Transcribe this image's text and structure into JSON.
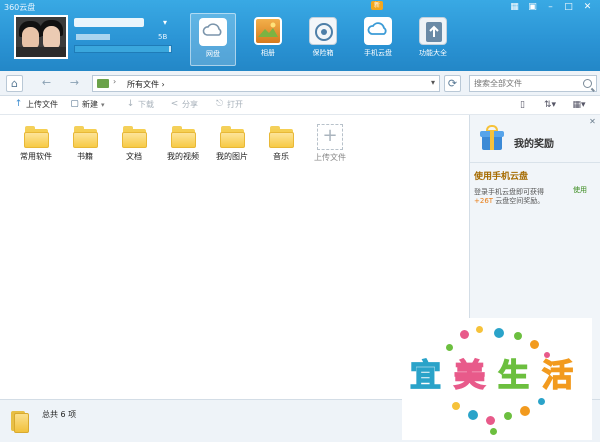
{
  "window": {
    "title": "360云盘",
    "controls": [
      {
        "name": "feedback-icon",
        "glyph": "▦"
      },
      {
        "name": "skin-icon",
        "glyph": "▣"
      },
      {
        "name": "minimize-icon",
        "glyph": "–"
      },
      {
        "name": "maximize-icon",
        "glyph": "□"
      },
      {
        "name": "close-icon",
        "glyph": "✕"
      }
    ]
  },
  "user": {
    "quota_label": "5B",
    "quota_used_fraction": 0.98,
    "menu_caret": "▾"
  },
  "nav": {
    "badge": "新",
    "items": [
      {
        "label": "网盘",
        "icon": "cloud-drive-icon",
        "active": true
      },
      {
        "label": "相册",
        "icon": "photo-album-icon",
        "active": false
      },
      {
        "label": "保险箱",
        "icon": "safe-box-icon",
        "active": false
      },
      {
        "label": "手机云盘",
        "icon": "mobile-cloud-icon",
        "active": false
      },
      {
        "label": "功能大全",
        "icon": "tools-icon",
        "active": false
      }
    ]
  },
  "addressbar": {
    "home_glyph": "⌂",
    "back_glyph": "←",
    "forward_glyph": "→",
    "path_separator": "›",
    "path_label": "所有文件 ›",
    "path_caret": "▾",
    "refresh_glyph": "⟳",
    "search_placeholder": "搜索全部文件"
  },
  "toolbar": {
    "upload": {
      "label": "上传文件",
      "glyph": "↑",
      "enabled": true
    },
    "new": {
      "label": "新建",
      "glyph": "▢",
      "caret": "▾",
      "enabled": true
    },
    "download": {
      "label": "下载",
      "glyph": "↓",
      "enabled": false
    },
    "share": {
      "label": "分享",
      "glyph": "<",
      "enabled": false
    },
    "open": {
      "label": "打开",
      "glyph": "⎋",
      "enabled": false
    },
    "view_controls": [
      {
        "name": "panel-toggle-icon",
        "glyph": "▯"
      },
      {
        "name": "sort-icon",
        "glyph": "⇅▾"
      },
      {
        "name": "grid-view-icon",
        "glyph": "▦▾"
      }
    ]
  },
  "files": [
    {
      "name": "常用软件"
    },
    {
      "name": "书籍"
    },
    {
      "name": "文档"
    },
    {
      "name": "我的视频"
    },
    {
      "name": "我的图片"
    },
    {
      "name": "音乐"
    }
  ],
  "upload_tile": {
    "glyph": "+",
    "label": "上传文件"
  },
  "rewards": {
    "title": "我的奖励",
    "close_glyph": "✕",
    "promo_title": "使用手机云盘",
    "promo_text_before": "登录手机云盘即可获得",
    "promo_highlight": "+26T",
    "promo_text_after": " 云盘空间奖励。",
    "promo_link": "使用"
  },
  "status": {
    "text": "总共 6 项"
  },
  "watermark": {
    "chars": [
      "宜",
      "美",
      "生",
      "活"
    ]
  },
  "colors": {
    "header_blue": "#2a93d4",
    "promo_title": "#a66b00",
    "promo_highlight": "#e97b12",
    "link_green": "#3b8c1f"
  }
}
